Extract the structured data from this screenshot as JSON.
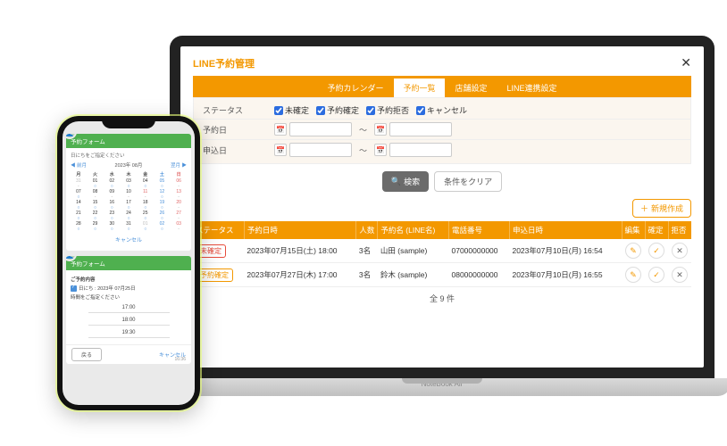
{
  "laptop": {
    "title": "LINE予約管理",
    "base_text": "NoteBook Air",
    "tabs": [
      "予約カレンダー",
      "予約一覧",
      "店舗設定",
      "LINE連携設定"
    ],
    "active_tab": 1,
    "filters": {
      "status_label": "ステータス",
      "statuses": [
        {
          "label": "未確定",
          "checked": true
        },
        {
          "label": "予約確定",
          "checked": true
        },
        {
          "label": "予約拒否",
          "checked": true
        },
        {
          "label": "キャンセル",
          "checked": true
        }
      ],
      "reserve_date_label": "予約日",
      "apply_date_label": "申込日",
      "tilde": "〜"
    },
    "buttons": {
      "search": "検索",
      "clear": "条件をクリア",
      "new": "新規作成"
    },
    "table": {
      "headers": [
        "ステータス",
        "予約日時",
        "人数",
        "予約名 (LINE名)",
        "電話番号",
        "申込日時",
        "編集",
        "確定",
        "拒否"
      ],
      "rows": [
        {
          "status": "未確定",
          "status_cls": "red",
          "datetime": "2023年07月15日(土) 18:00",
          "count": "3名",
          "name": "山田 (sample)",
          "phone": "07000000000",
          "applied": "2023年07月10日(月) 16:54"
        },
        {
          "status": "予約確定",
          "status_cls": "orange",
          "datetime": "2023年07月27日(木) 17:00",
          "count": "3名",
          "name": "鈴木 (sample)",
          "phone": "08000000000",
          "applied": "2023年07月10日(月) 16:55"
        }
      ],
      "total": "全 9 件"
    }
  },
  "phone": {
    "card1": {
      "title": "予約フォーム",
      "subtitle": "日にちをご指定ください",
      "nav_prev": "前月",
      "nav_next": "翌月",
      "month": "2023年 08月",
      "dow": [
        "月",
        "火",
        "水",
        "木",
        "金",
        "土",
        "日"
      ],
      "cancel": "キャンセル"
    },
    "card2": {
      "title": "予約フォーム",
      "section": "ご予約内容",
      "date_line": "日にち : 2023年 07月25日",
      "time_label": "時間をご指定ください",
      "times": [
        "17:00",
        "18:00",
        "19:30"
      ],
      "back": "戻る",
      "cancel": "キャンセル",
      "stamp": "16:36"
    }
  },
  "calendar_cells": [
    {
      "d": "31",
      "m": true
    },
    {
      "d": "01"
    },
    {
      "d": "02"
    },
    {
      "d": "03"
    },
    {
      "d": "04"
    },
    {
      "d": "05",
      "sat": true
    },
    {
      "d": "06",
      "sun": true
    },
    {
      "d": "07"
    },
    {
      "d": "08"
    },
    {
      "d": "09"
    },
    {
      "d": "10"
    },
    {
      "d": "11",
      "sun": true
    },
    {
      "d": "12",
      "sat": true
    },
    {
      "d": "13",
      "sun": true
    },
    {
      "d": "14"
    },
    {
      "d": "15"
    },
    {
      "d": "16"
    },
    {
      "d": "17"
    },
    {
      "d": "18"
    },
    {
      "d": "19",
      "sat": true
    },
    {
      "d": "20",
      "sun": true
    },
    {
      "d": "21"
    },
    {
      "d": "22"
    },
    {
      "d": "23"
    },
    {
      "d": "24"
    },
    {
      "d": "25"
    },
    {
      "d": "26",
      "sat": true
    },
    {
      "d": "27",
      "sun": true
    },
    {
      "d": "28"
    },
    {
      "d": "29"
    },
    {
      "d": "30"
    },
    {
      "d": "31"
    },
    {
      "d": "01",
      "m": true
    },
    {
      "d": "02",
      "m": true,
      "sat": true
    },
    {
      "d": "03",
      "m": true,
      "sun": true
    }
  ],
  "calendar_marks": [
    "-",
    "○",
    "○",
    "○",
    "○",
    "○",
    "-",
    "○",
    "-",
    "-",
    "-",
    "-",
    "○",
    "-",
    "○",
    "○",
    "○",
    "○",
    "○",
    "○",
    "-",
    "○",
    "○",
    "○",
    "○",
    "○",
    "○",
    "-",
    "○",
    "○",
    "○",
    "○",
    "○",
    "○",
    "-"
  ]
}
